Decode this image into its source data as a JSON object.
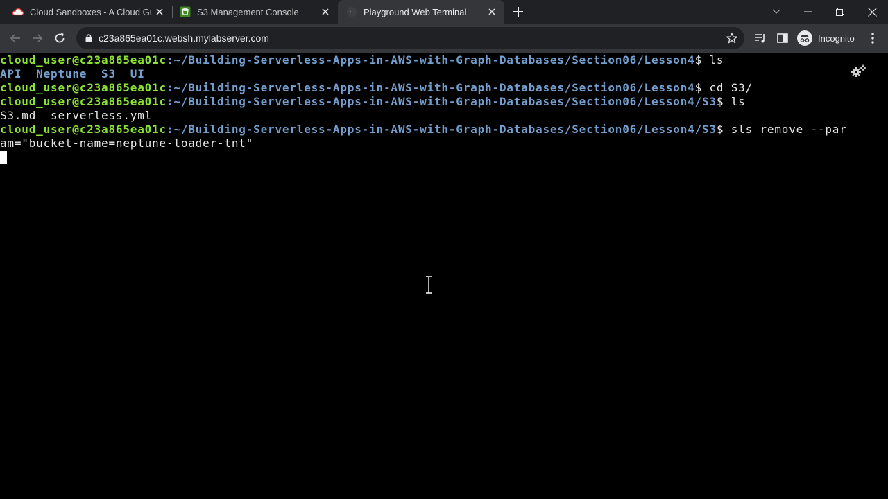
{
  "browser": {
    "tabs": [
      {
        "title": "Cloud Sandboxes - A Cloud Guru",
        "icon": "cloud-guru-favicon-icon",
        "active": false
      },
      {
        "title": "S3 Management Console",
        "icon": "aws-s3-favicon-icon",
        "active": false
      },
      {
        "title": "Playground Web Terminal",
        "icon": "terminal-favicon-icon",
        "active": true
      }
    ],
    "url": "c23a865ea01c.websh.mylabserver.com",
    "profile_label": "Incognito"
  },
  "terminal": {
    "prompt_user": "cloud_user@c23a865ea01c",
    "lines": [
      {
        "path": ":~/Building-Serverless-Apps-in-AWS-with-Graph-Databases/Section06/Lesson4",
        "cmd": "$ ls"
      },
      {
        "dirs": "API  Neptune  S3  UI"
      },
      {
        "path": ":~/Building-Serverless-Apps-in-AWS-with-Graph-Databases/Section06/Lesson4",
        "cmd": "$ cd S3/"
      },
      {
        "path": ":~/Building-Serverless-Apps-in-AWS-with-Graph-Databases/Section06/Lesson4/S3",
        "cmd": "$ ls"
      },
      {
        "output": "S3.md  serverless.yml"
      },
      {
        "path": ":~/Building-Serverless-Apps-in-AWS-with-Graph-Databases/Section06/Lesson4/S3",
        "cmd": "$ sls remove --par"
      },
      {
        "output": "am=\"bucket-name=neptune-loader-tnt\""
      }
    ]
  },
  "colors": {
    "tab_strip": "#202124",
    "toolbar": "#35363a",
    "prompt_user": "#8ae234",
    "prompt_path": "#729fcf",
    "terminal_bg": "#000000"
  }
}
